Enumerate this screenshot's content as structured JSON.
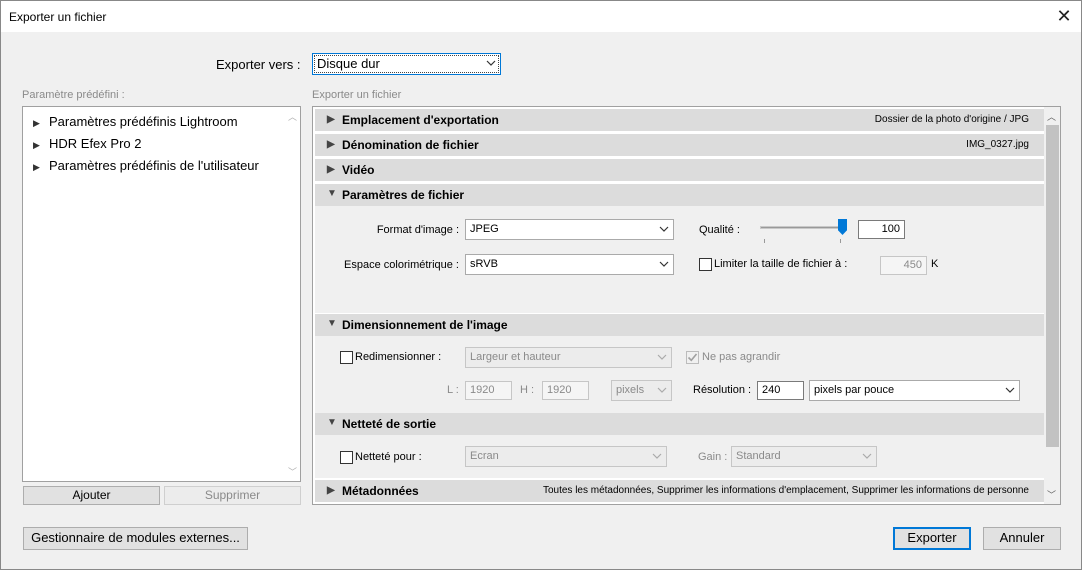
{
  "window": {
    "title": "Exporter un fichier"
  },
  "export_to": {
    "label": "Exporter vers :",
    "value": "Disque dur"
  },
  "presets": {
    "label": "Paramètre prédéfini :",
    "items": [
      "Paramètres prédéfinis Lightroom",
      "HDR Efex Pro 2",
      "Paramètres prédéfinis de l'utilisateur"
    ],
    "add_button": "Ajouter",
    "remove_button": "Supprimer"
  },
  "panel": {
    "label": "Exporter un fichier",
    "sections": {
      "export_location": {
        "title": "Emplacement d'exportation",
        "summary": "Dossier de la photo d'origine / JPG"
      },
      "file_naming": {
        "title": "Dénomination de fichier",
        "summary": "IMG_0327.jpg"
      },
      "video": {
        "title": "Vidéo"
      },
      "file_settings": {
        "title": "Paramètres de fichier",
        "format_label": "Format d'image :",
        "format_value": "JPEG",
        "quality_label": "Qualité :",
        "quality_value": "100",
        "quality_fraction": 1.0,
        "colorspace_label": "Espace colorimétrique :",
        "colorspace_value": "sRVB",
        "limit_label": "Limiter la taille de fichier à :",
        "limit_value": "450",
        "limit_unit": "K"
      },
      "image_sizing": {
        "title": "Dimensionnement de l'image",
        "resize_label": "Redimensionner :",
        "resize_mode": "Largeur et hauteur",
        "dont_enlarge_label": "Ne pas agrandir",
        "w_label": "L :",
        "w_value": "1920",
        "h_label": "H :",
        "h_value": "1920",
        "unit_value": "pixels",
        "resolution_label": "Résolution :",
        "resolution_value": "240",
        "resolution_unit": "pixels par pouce"
      },
      "output_sharpening": {
        "title": "Netteté de sortie",
        "sharpen_label": "Netteté pour :",
        "sharpen_value": "Ecran",
        "amount_label": "Gain :",
        "amount_value": "Standard"
      },
      "metadata": {
        "title": "Métadonnées",
        "summary": "Toutes les métadonnées, Supprimer les informations d'emplacement, Supprimer les informations de personne"
      }
    }
  },
  "footer": {
    "plugin_manager": "Gestionnaire de modules externes...",
    "export_button": "Exporter",
    "cancel_button": "Annuler"
  },
  "colors": {
    "accent": "#0078d7",
    "header_bg": "#dcdcdc",
    "dialog_bg": "#f0f0f0"
  }
}
